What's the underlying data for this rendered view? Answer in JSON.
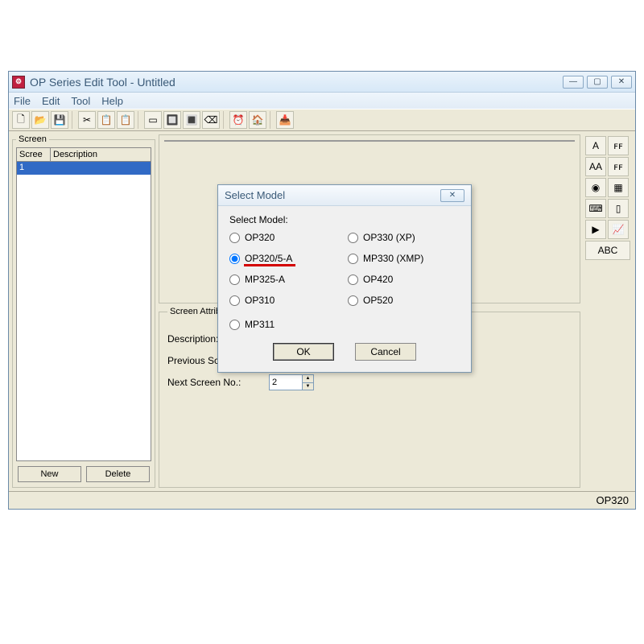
{
  "window": {
    "title": "OP Series Edit Tool - Untitled",
    "menus": {
      "file": "File",
      "edit": "Edit",
      "tool": "Tool",
      "help": "Help"
    },
    "toolbar_icons": [
      "🗋",
      "📂",
      "💾",
      "✂",
      "📋",
      "📋",
      "▭",
      "🔲",
      "🔳",
      "⌫",
      "⏰",
      "🏠",
      "📥"
    ],
    "side_icons": [
      "A",
      "ꜰꜰ",
      "AA",
      "ꜰꜰ",
      "◉",
      "▦",
      "⌨",
      "▯",
      "▶",
      "📈",
      "ABC"
    ]
  },
  "screen_panel": {
    "legend": "Screen",
    "col1": "Scree",
    "col2": "Description",
    "row1_id": "1",
    "row1_desc": "",
    "btn_new": "New",
    "btn_delete": "Delete"
  },
  "attrs": {
    "legend": "Screen Attribute",
    "desc_label": "Description:",
    "desc_value": "",
    "prev_label": "Previous Screen No.:",
    "next_label": "Next Screen No.:",
    "next_value": "2"
  },
  "statusbar": {
    "model": "OP320"
  },
  "dialog": {
    "title": "Select Model",
    "heading": "Select Model:",
    "options": {
      "op320": "OP320",
      "op330xp": "OP330 (XP)",
      "op3205a": "OP320/5-A",
      "mp330xmp": "MP330 (XMP)",
      "mp325a": "MP325-A",
      "op420": "OP420",
      "op310": "OP310",
      "op520": "OP520",
      "mp311": "MP311"
    },
    "selected": "op3205a",
    "ok": "OK",
    "cancel": "Cancel"
  }
}
